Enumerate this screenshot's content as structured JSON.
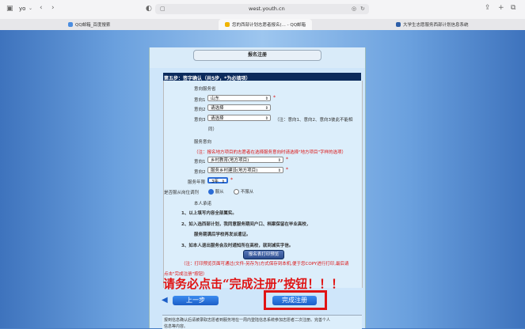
{
  "browser": {
    "profile_label": "yo",
    "url": "west.youth.cn",
    "tabs": [
      {
        "label": "QQ邮箱_百度搜索"
      },
      {
        "label": "您的西部计划志愿者报名(... - QQ邮箱"
      },
      {
        "label": "大学生志愿服务西部计划信息系统"
      }
    ]
  },
  "form": {
    "title": "报名注册",
    "step_header": "第五步：签字确认（共5步，*为必填项）",
    "section_intent": "意向服务省",
    "intent1_label": "意向1",
    "intent1_value": "山东",
    "intent2_label": "意向2",
    "intent2_value": "请选择",
    "intent3_label": "意向3",
    "intent3_value": "请选择",
    "intent_note": "（注：意向1、意向2、意向3彼此不能相",
    "intent_note2": "同）",
    "section_service": "服务意向",
    "service_note": "（注：报名地方项目的志愿者在选择服务意向时请选择\"地方项目\"字样的选项）",
    "service1_label": "意向1",
    "service1_value": "乡村教育(地方项目)",
    "service2_label": "意向2",
    "service2_value": "服务乡村建设(地方项目)",
    "term_label": "服务年限",
    "term_value": "3年",
    "adjust_label": "是否服从岗位调剂",
    "adjust_yes": "服从",
    "adjust_no": "不服从",
    "promise_title": "本人承诺",
    "promise1": "1、以上填写内容全部属实。",
    "promise2": "2、如入选西部计划，我同意服务期间户口、档案保留在毕业高校，",
    "promise2b": "服务期满后学校再发派遣证。",
    "promise3": "3、如本人退出服务会及时通知所在高校，就到减实字信。",
    "print_btn": "报名表打印预览",
    "print_note": "（注：打印预览页面可通过(文件-另存为)方式保存到本机,便于您COPY进行打印,最后请",
    "print_note2": "点击\"完成注册\"按钮）",
    "warning": "请务必点击“完成注册”按钮！！！",
    "prev_button": "上一步",
    "finish_button": "完成注册",
    "footer_text": "报到信息确认后请被录取志愿者到服务地在一周内登陆信息系统参加志愿者二次注册。完善个人",
    "footer_text2": "信息等内容。"
  },
  "colors": {
    "accent": "#1c5ec7",
    "alert": "#e01414",
    "header": "#0b2a5c"
  }
}
